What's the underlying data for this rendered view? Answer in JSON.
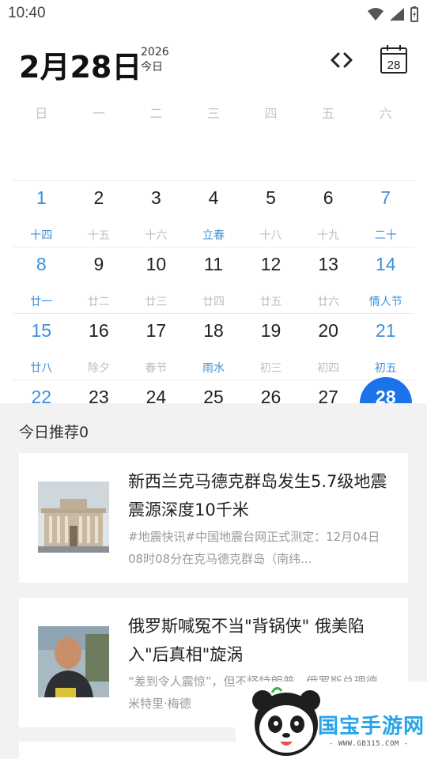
{
  "status_bar": {
    "time": "10:40",
    "icons": [
      "wifi-icon",
      "signal-icon",
      "battery-charging-icon"
    ]
  },
  "header": {
    "date_title": "2月28日",
    "year": "2026",
    "today_label": "今日",
    "calendar_button_day": "28"
  },
  "weekdays": [
    "日",
    "一",
    "二",
    "三",
    "四",
    "五",
    "六"
  ],
  "calendar": {
    "rows": [
      {
        "days": [
          "1",
          "2",
          "3",
          "4",
          "5",
          "6",
          "7"
        ],
        "lunar": [
          "",
          "",
          "",
          "",
          "",
          "",
          ""
        ]
      },
      {
        "days": [
          "8",
          "9",
          "10",
          "11",
          "12",
          "13",
          "14"
        ],
        "lunar": [
          "十四",
          "十五",
          "十六",
          "立春",
          "十八",
          "十九",
          "二十"
        ]
      },
      {
        "days": [
          "15",
          "16",
          "17",
          "18",
          "19",
          "20",
          "21"
        ],
        "lunar": [
          "廿一",
          "廿二",
          "廿三",
          "廿四",
          "廿五",
          "廿六",
          "情人节"
        ]
      },
      {
        "days": [
          "22",
          "23",
          "24",
          "25",
          "26",
          "27",
          "28"
        ],
        "lunar": [
          "廿八",
          "除夕",
          "春节",
          "雨水",
          "初三",
          "初四",
          "初五"
        ]
      }
    ],
    "selected_day": "28"
  },
  "recommend": {
    "title": "今日推荐0",
    "cards": [
      {
        "title": "新西兰克马德克群岛发生5.7级地震 震源深度10千米",
        "desc": "#地震快讯#中国地震台网正式测定：12月04日08时08分在克马德克群岛（南纬..."
      },
      {
        "title": "俄罗斯喊冤不当\"背锅侠\" 俄美陷入\"后真相\"旋涡",
        "desc": "“差到令人震惊”，但不怪特朗普。俄罗斯总理德米特里·梅德"
      }
    ]
  },
  "watermark": {
    "brand": "国宝手游网",
    "url": "- WWW.GB315.COM -"
  },
  "colors": {
    "accent": "#1a73e8",
    "weekend": "#3d8fd9",
    "panel_bg": "#f2f2f2",
    "brand_blue": "#27a4e8"
  }
}
